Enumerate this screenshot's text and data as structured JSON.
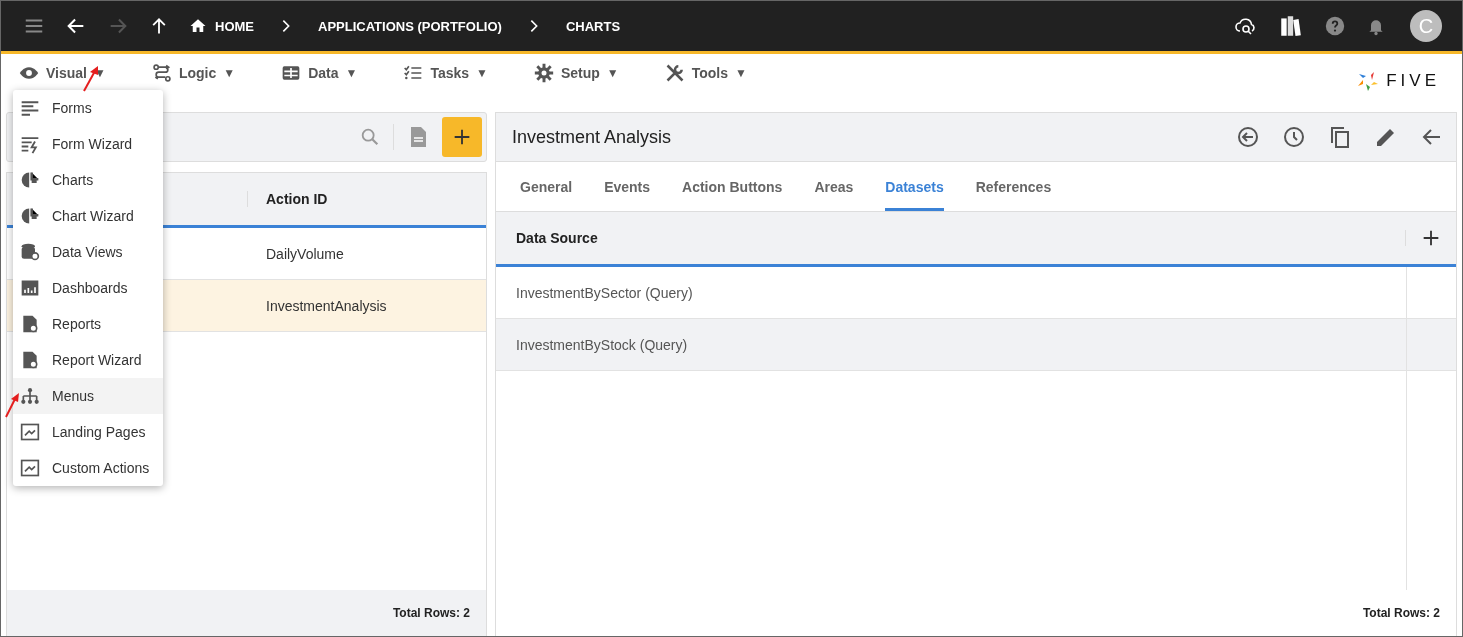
{
  "top_bar": {
    "breadcrumbs": [
      "HOME",
      "APPLICATIONS (PORTFOLIO)",
      "CHARTS"
    ],
    "avatar": "C"
  },
  "menu_bar": [
    {
      "label": "Visual"
    },
    {
      "label": "Logic"
    },
    {
      "label": "Data"
    },
    {
      "label": "Tasks"
    },
    {
      "label": "Setup"
    },
    {
      "label": "Tools"
    }
  ],
  "caret": "▼",
  "logo": "FIVE",
  "dropdown": [
    {
      "label": "Forms",
      "highlighted": false
    },
    {
      "label": "Form Wizard",
      "highlighted": false
    },
    {
      "label": "Charts",
      "highlighted": false
    },
    {
      "label": "Chart Wizard",
      "highlighted": false
    },
    {
      "label": "Data Views",
      "highlighted": false
    },
    {
      "label": "Dashboards",
      "highlighted": false
    },
    {
      "label": "Reports",
      "highlighted": false
    },
    {
      "label": "Report Wizard",
      "highlighted": false
    },
    {
      "label": "Menus",
      "highlighted": true
    },
    {
      "label": "Landing Pages",
      "highlighted": false
    },
    {
      "label": "Custom Actions",
      "highlighted": false
    }
  ],
  "left_panel": {
    "column": "Action ID",
    "rows": [
      {
        "value": "DailyVolume",
        "selected": false
      },
      {
        "value": "InvestmentAnalysis",
        "selected": true
      }
    ],
    "footer": "Total Rows: 2"
  },
  "right_panel": {
    "title": "Investment Analysis",
    "tabs": [
      {
        "label": "General",
        "selected": false
      },
      {
        "label": "Events",
        "selected": false
      },
      {
        "label": "Action Buttons",
        "selected": false
      },
      {
        "label": "Areas",
        "selected": false
      },
      {
        "label": "Datasets",
        "selected": true
      },
      {
        "label": "References",
        "selected": false
      }
    ],
    "column": "Data Source",
    "rows": [
      {
        "value": "InvestmentBySector (Query)",
        "selected": false
      },
      {
        "value": "InvestmentByStock (Query)",
        "selected": true
      }
    ],
    "footer": "Total Rows: 2"
  }
}
